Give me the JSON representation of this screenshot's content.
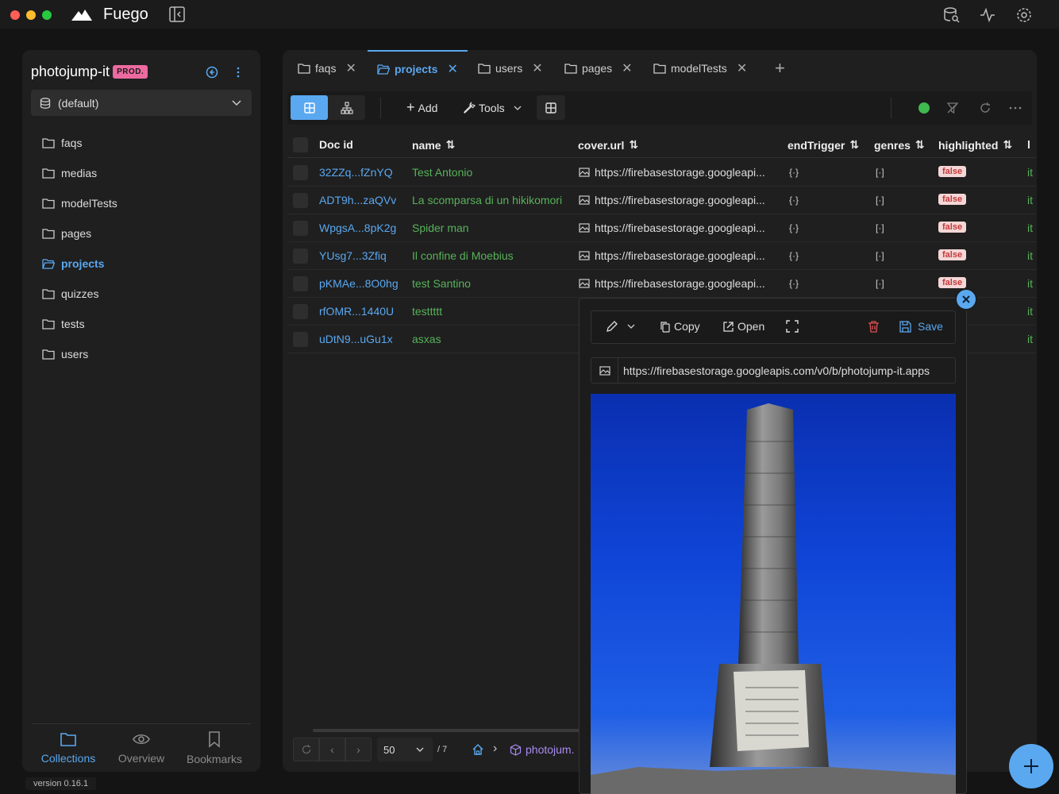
{
  "app": {
    "name": "Fuego",
    "version": "version 0.16.1"
  },
  "project": {
    "name": "photojump-it",
    "badge": "PROD.",
    "database": "(default)"
  },
  "sidebar": {
    "items": [
      {
        "label": "faqs"
      },
      {
        "label": "medias"
      },
      {
        "label": "modelTests"
      },
      {
        "label": "pages"
      },
      {
        "label": "projects",
        "active": true
      },
      {
        "label": "quizzes"
      },
      {
        "label": "tests"
      },
      {
        "label": "users"
      }
    ]
  },
  "bottom_nav": {
    "collections": "Collections",
    "overview": "Overview",
    "bookmarks": "Bookmarks"
  },
  "tabs": [
    {
      "label": "faqs"
    },
    {
      "label": "projects",
      "active": true
    },
    {
      "label": "users"
    },
    {
      "label": "pages"
    },
    {
      "label": "modelTests"
    }
  ],
  "toolbar": {
    "add": "Add",
    "tools": "Tools",
    "status_color": "#3fb950"
  },
  "table": {
    "columns": [
      "Doc id",
      "name",
      "cover.url",
      "endTrigger",
      "genres",
      "highlighted",
      "l"
    ],
    "rows": [
      {
        "id": "32ZZq...fZnYQ",
        "name": "Test Antonio",
        "url": "https://firebasestorage.googleapi...",
        "highlighted": "false",
        "extra": "it"
      },
      {
        "id": "ADT9h...zaQVv",
        "name": "La scomparsa di un hikikomori",
        "url": "https://firebasestorage.googleapi...",
        "highlighted": "false",
        "extra": "it"
      },
      {
        "id": "WpgsA...8pK2g",
        "name": "Spider man",
        "url": "https://firebasestorage.googleapi...",
        "highlighted": "false",
        "extra": "it"
      },
      {
        "id": "YUsg7...3Zfiq",
        "name": "Il confine di Moebius",
        "url": "https://firebasestorage.googleapi...",
        "highlighted": "false",
        "extra": "it"
      },
      {
        "id": "pKMAe...8O0hg",
        "name": "test Santino",
        "url": "https://firebasestorage.googleapi...",
        "highlighted": "false",
        "extra": "it"
      },
      {
        "id": "rfOMR...1440U",
        "name": "testtttt",
        "extra": "it"
      },
      {
        "id": "uDtN9...uGu1x",
        "name": "asxas",
        "extra": "it"
      }
    ]
  },
  "pager": {
    "page_size": "50",
    "total_pages": "/ 7",
    "breadcrumb": "photojum."
  },
  "popup": {
    "copy": "Copy",
    "open": "Open",
    "save": "Save",
    "url": "https://firebasestorage.googleapis.com/v0/b/photojump-it.apps"
  },
  "colors": {
    "accent": "#5aa8f0",
    "green": "#57b25a",
    "badge_pink": "#ec6aa0"
  }
}
